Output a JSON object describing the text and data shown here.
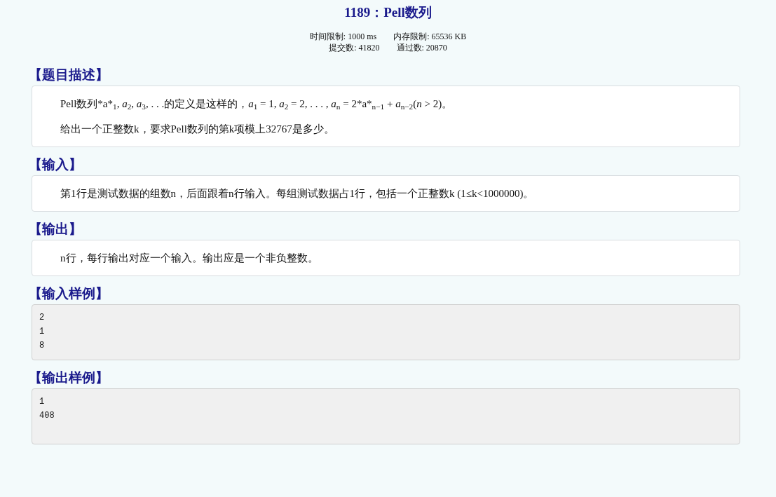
{
  "title": "1189：Pell数列",
  "stats": [
    [
      "时间限制: 1000 ms",
      "内存限制: 65536 KB"
    ],
    [
      "提交数: 41820",
      "通过数: 20870"
    ]
  ],
  "sections": [
    {
      "heading": "【题目描述】",
      "kind": "text",
      "paragraphs": [
        "Pell数列*a*$_{1}$, *a*$_{2}$, *a*$_{3}$, . . .的定义是这样的，*a*$_{1}$ = 1, *a*$_{2}$ = 2, . . . , *a*$_{n}$ = 2*a*$_{n−1}$ + *a*$_{n−2}$(*n* > 2)。",
        "给出一个正整数k，要求Pell数列的第k项模上32767是多少。"
      ]
    },
    {
      "heading": "【输入】",
      "kind": "text",
      "paragraphs": [
        "第1行是测试数据的组数n，后面跟着n行输入。每组测试数据占1行，包括一个正整数k (1≤k<1000000)。"
      ]
    },
    {
      "heading": "【输出】",
      "kind": "text",
      "paragraphs": [
        "n行，每行输出对应一个输入。输出应是一个非负整数。"
      ]
    },
    {
      "heading": "【输入样例】",
      "kind": "sample",
      "lines": [
        "2",
        "1",
        "8"
      ]
    },
    {
      "heading": "【输出样例】",
      "kind": "sample",
      "lines": [
        "1",
        "408"
      ]
    }
  ]
}
